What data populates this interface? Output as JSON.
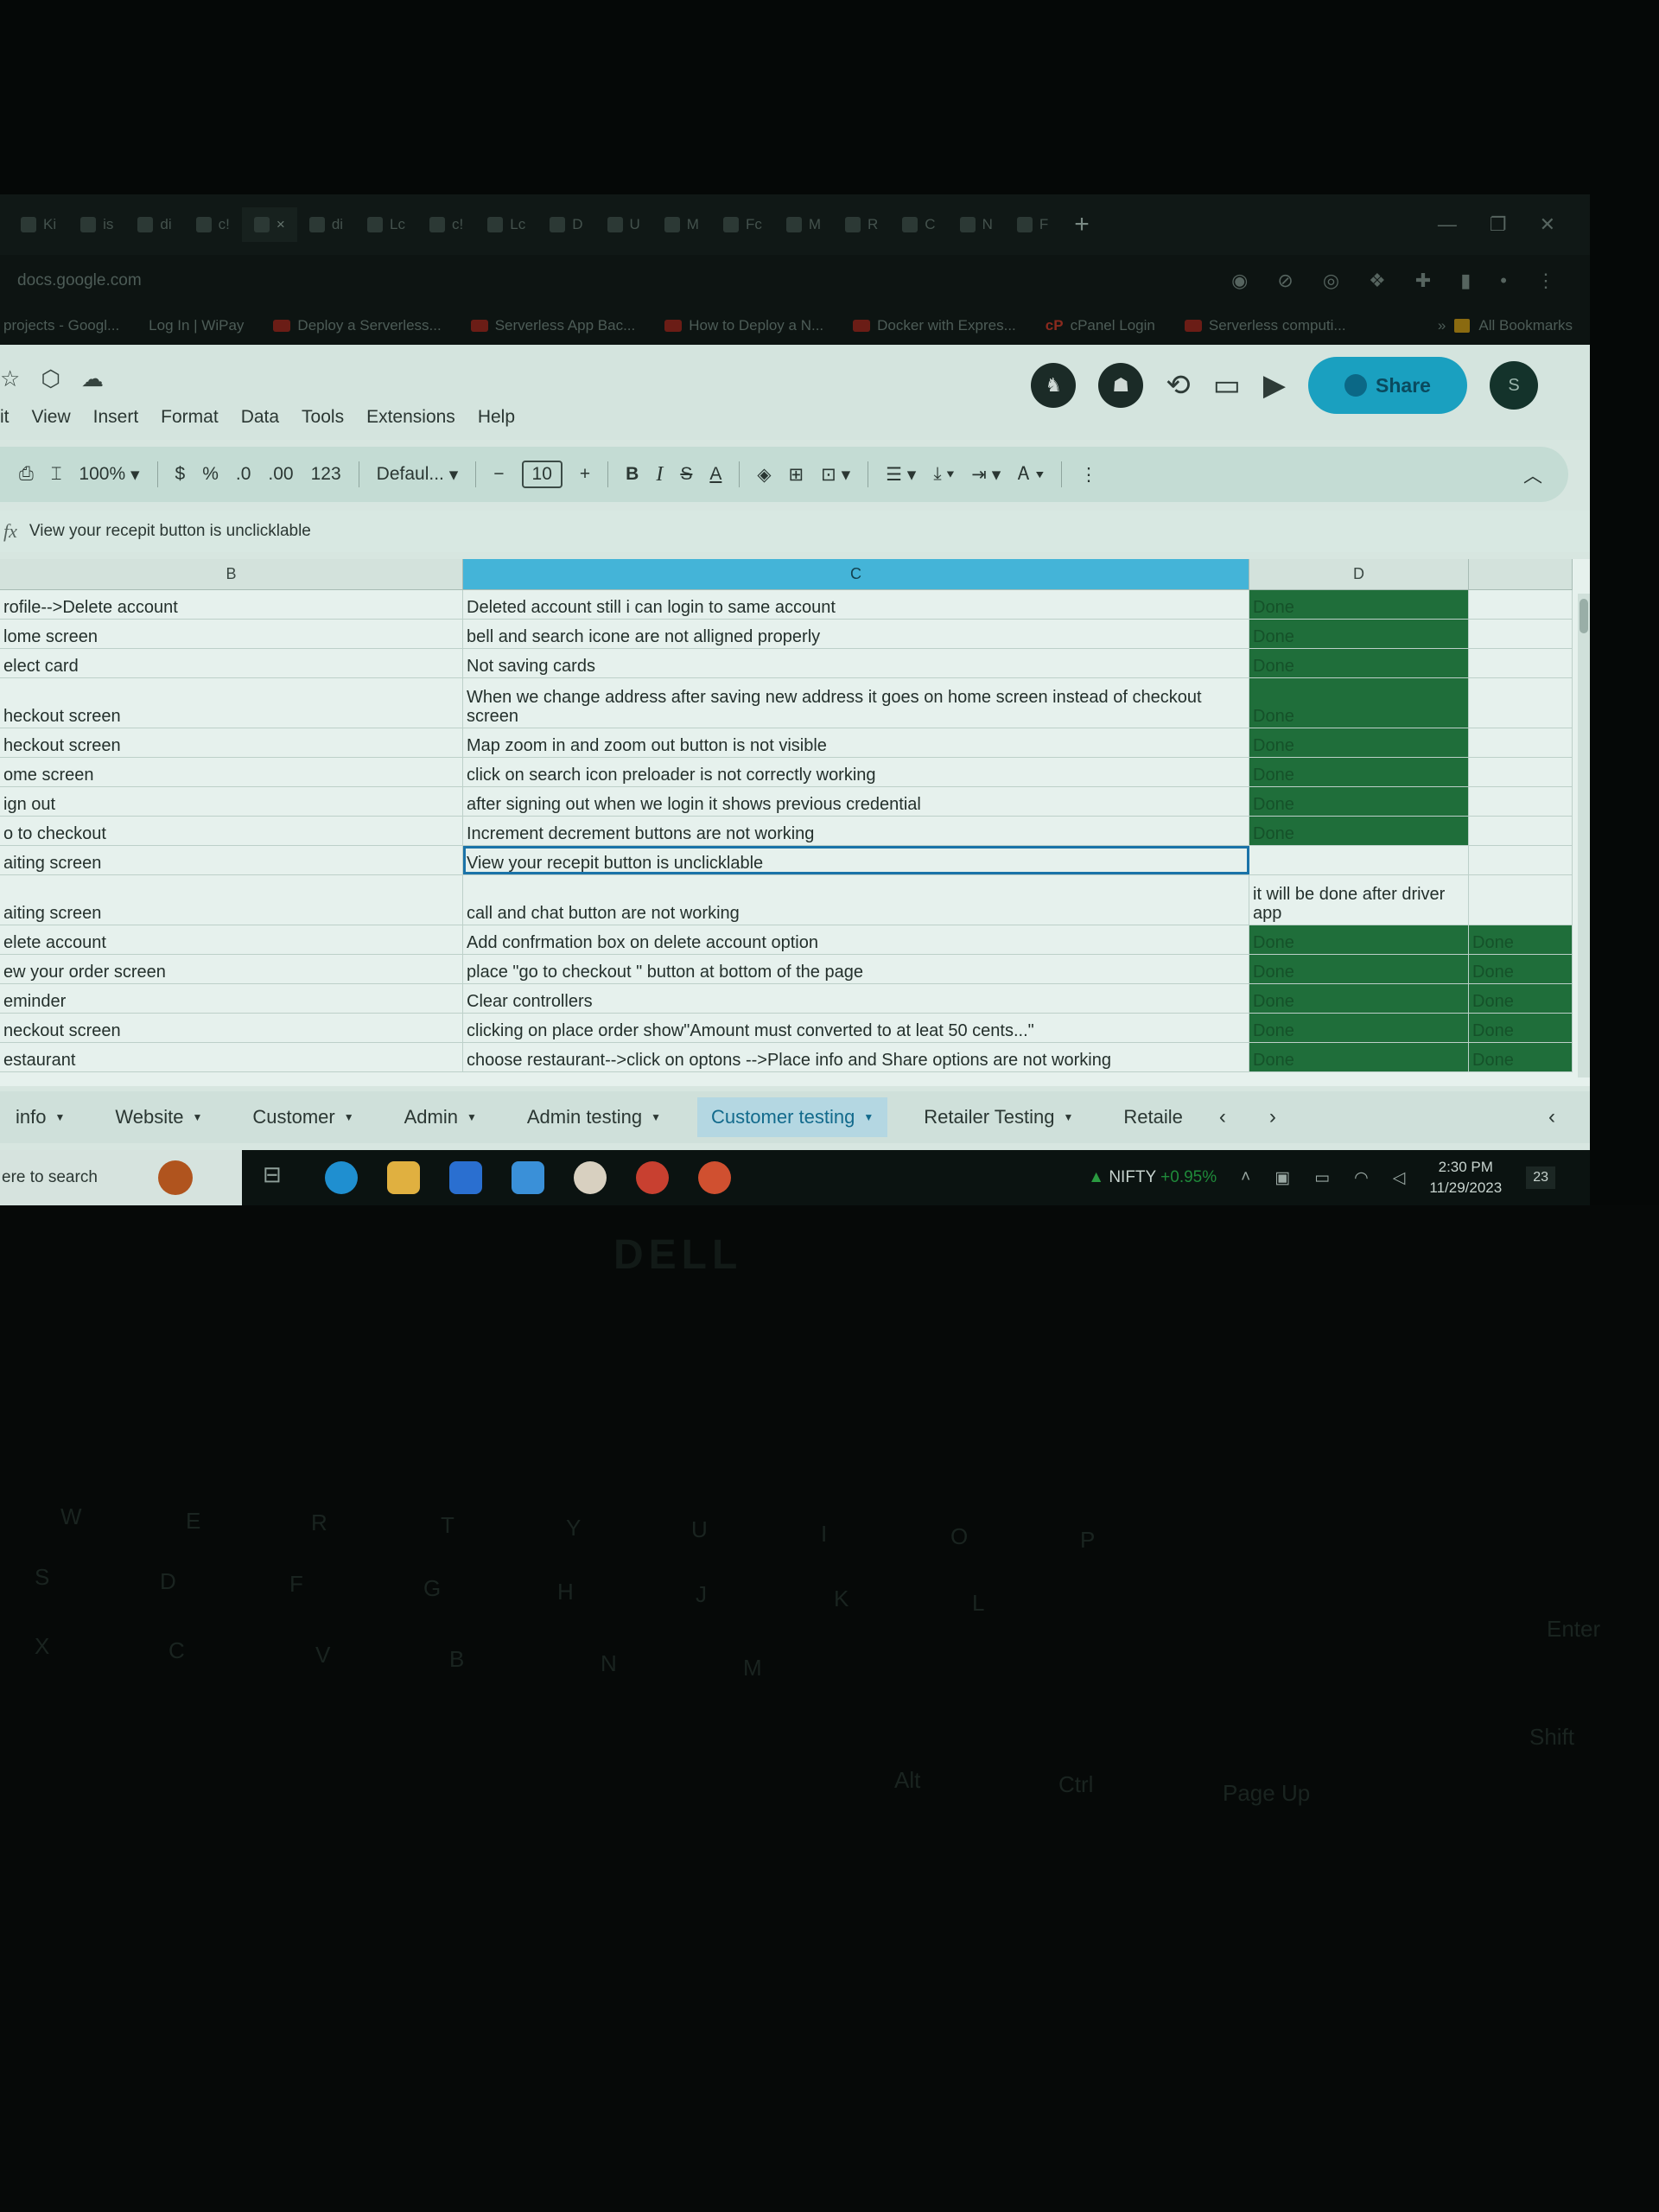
{
  "browser": {
    "tabs": [
      {
        "label": "Ki"
      },
      {
        "label": "is"
      },
      {
        "label": "di"
      },
      {
        "label": "c!"
      },
      {
        "label": "×"
      },
      {
        "label": "di"
      },
      {
        "label": "Lc"
      },
      {
        "label": "c!"
      },
      {
        "label": "Lc"
      },
      {
        "label": "D"
      },
      {
        "label": "U"
      },
      {
        "label": "M"
      },
      {
        "label": "Fc"
      },
      {
        "label": "M"
      },
      {
        "label": "R"
      },
      {
        "label": "C"
      },
      {
        "label": "N"
      },
      {
        "label": "F"
      }
    ],
    "new_tab": "+",
    "url": "docs.google.com",
    "bookmarks": [
      {
        "label": "projects - Googl...",
        "icon": "none"
      },
      {
        "label": "Log In | WiPay",
        "icon": "none"
      },
      {
        "label": "Deploy a Serverless...",
        "icon": "youtube"
      },
      {
        "label": "Serverless App Bac...",
        "icon": "youtube"
      },
      {
        "label": "How to Deploy a N...",
        "icon": "youtube"
      },
      {
        "label": "Docker with Expres...",
        "icon": "youtube"
      },
      {
        "label": "cPanel Login",
        "icon": "cpanel"
      },
      {
        "label": "Serverless computi...",
        "icon": "youtube"
      }
    ],
    "more_bookmarks": "»",
    "all_bookmarks": "All Bookmarks"
  },
  "sheets": {
    "menus": [
      "it",
      "View",
      "Insert",
      "Format",
      "Data",
      "Tools",
      "Extensions",
      "Help"
    ],
    "share_label": "Share",
    "avatar_letter": "S",
    "toolbar": {
      "zoom": "100%",
      "currency": "$",
      "percent": "%",
      "dec_decrease": ".0",
      "dec_increase": ".00",
      "number_format": "123",
      "font": "Defaul...",
      "minus": "−",
      "font_size": "10",
      "plus": "+",
      "bold": "B",
      "italic": "I",
      "strike": "S",
      "text_color": "A"
    },
    "formula": {
      "fx": "fx",
      "content": "View your recepit button is unclicklable"
    },
    "columns": [
      "B",
      "C",
      "D"
    ],
    "rows": [
      {
        "b": "rofile-->Delete account",
        "c": "Deleted account still i can login to same account",
        "d": "Done",
        "e": ""
      },
      {
        "b": "lome screen",
        "c": "bell and search icone are not alligned properly",
        "d": "Done",
        "e": ""
      },
      {
        "b": "elect card",
        "c": "Not saving cards",
        "d": "Done",
        "e": ""
      },
      {
        "b": "heckout screen",
        "c": "When we change address after saving new address it goes on home screen instead of checkout screen",
        "d": "Done",
        "e": ""
      },
      {
        "b": "heckout  screen",
        "c": "Map zoom in and zoom out button is not visible",
        "d": "Done",
        "e": ""
      },
      {
        "b": "ome screen",
        "c": "click on search icon preloader is not correctly working",
        "d": "Done",
        "e": ""
      },
      {
        "b": "ign out",
        "c": "after signing out when we login it shows previous credential",
        "d": "Done",
        "e": ""
      },
      {
        "b": "o to checkout",
        "c": "Increment decrement buttons are not working",
        "d": "Done",
        "e": ""
      },
      {
        "b": "aiting screen",
        "c": "View your recepit button is unclicklable",
        "d": "",
        "e": ""
      },
      {
        "b": "aiting screen",
        "c": "call and chat button are not working",
        "d": "it will be done after driver app",
        "e": ""
      },
      {
        "b": "elete account",
        "c": "Add confrmation box on delete account option",
        "d": "Done",
        "e": "Done"
      },
      {
        "b": "ew your order screen",
        "c": "place \"go to checkout \" button at bottom of the page",
        "d": "Done",
        "e": "Done"
      },
      {
        "b": "eminder",
        "c": "Clear controllers",
        "d": "Done",
        "e": "Done"
      },
      {
        "b": "neckout screen",
        "c": "clicking on place order show\"Amount must converted to at leat 50 cents...\"",
        "d": "Done",
        "e": "Done"
      },
      {
        "b": "estaurant",
        "c": "choose restaurant-->click on optons -->Place info and Share options are not working",
        "d": "Done",
        "e": "Done"
      }
    ],
    "sheet_tabs": [
      "info",
      "Website",
      "Customer",
      "Admin",
      "Admin testing",
      "Customer testing",
      "Retailer Testing",
      "Retaile"
    ],
    "active_sheet": "Customer testing"
  },
  "taskbar": {
    "search_placeholder": "ere to search",
    "nifty_label": "NIFTY",
    "nifty_change": "+0.95%",
    "time": "2:30 PM",
    "date": "11/29/2023",
    "notifications": "23"
  },
  "laptop": {
    "brand": "DELL",
    "keys": [
      "W",
      "E",
      "R",
      "T",
      "Y",
      "U",
      "I",
      "O",
      "P",
      "S",
      "D",
      "F",
      "G",
      "H",
      "J",
      "K",
      "L",
      "X",
      "C",
      "V",
      "B",
      "N",
      "M",
      "Alt",
      "Ctrl",
      "Page Up",
      "Shift",
      "Enter"
    ]
  },
  "colors": {
    "done_fill": "#1f6e3a",
    "selected_column": "#44b4d8",
    "share_button": "#1aa0c0"
  }
}
